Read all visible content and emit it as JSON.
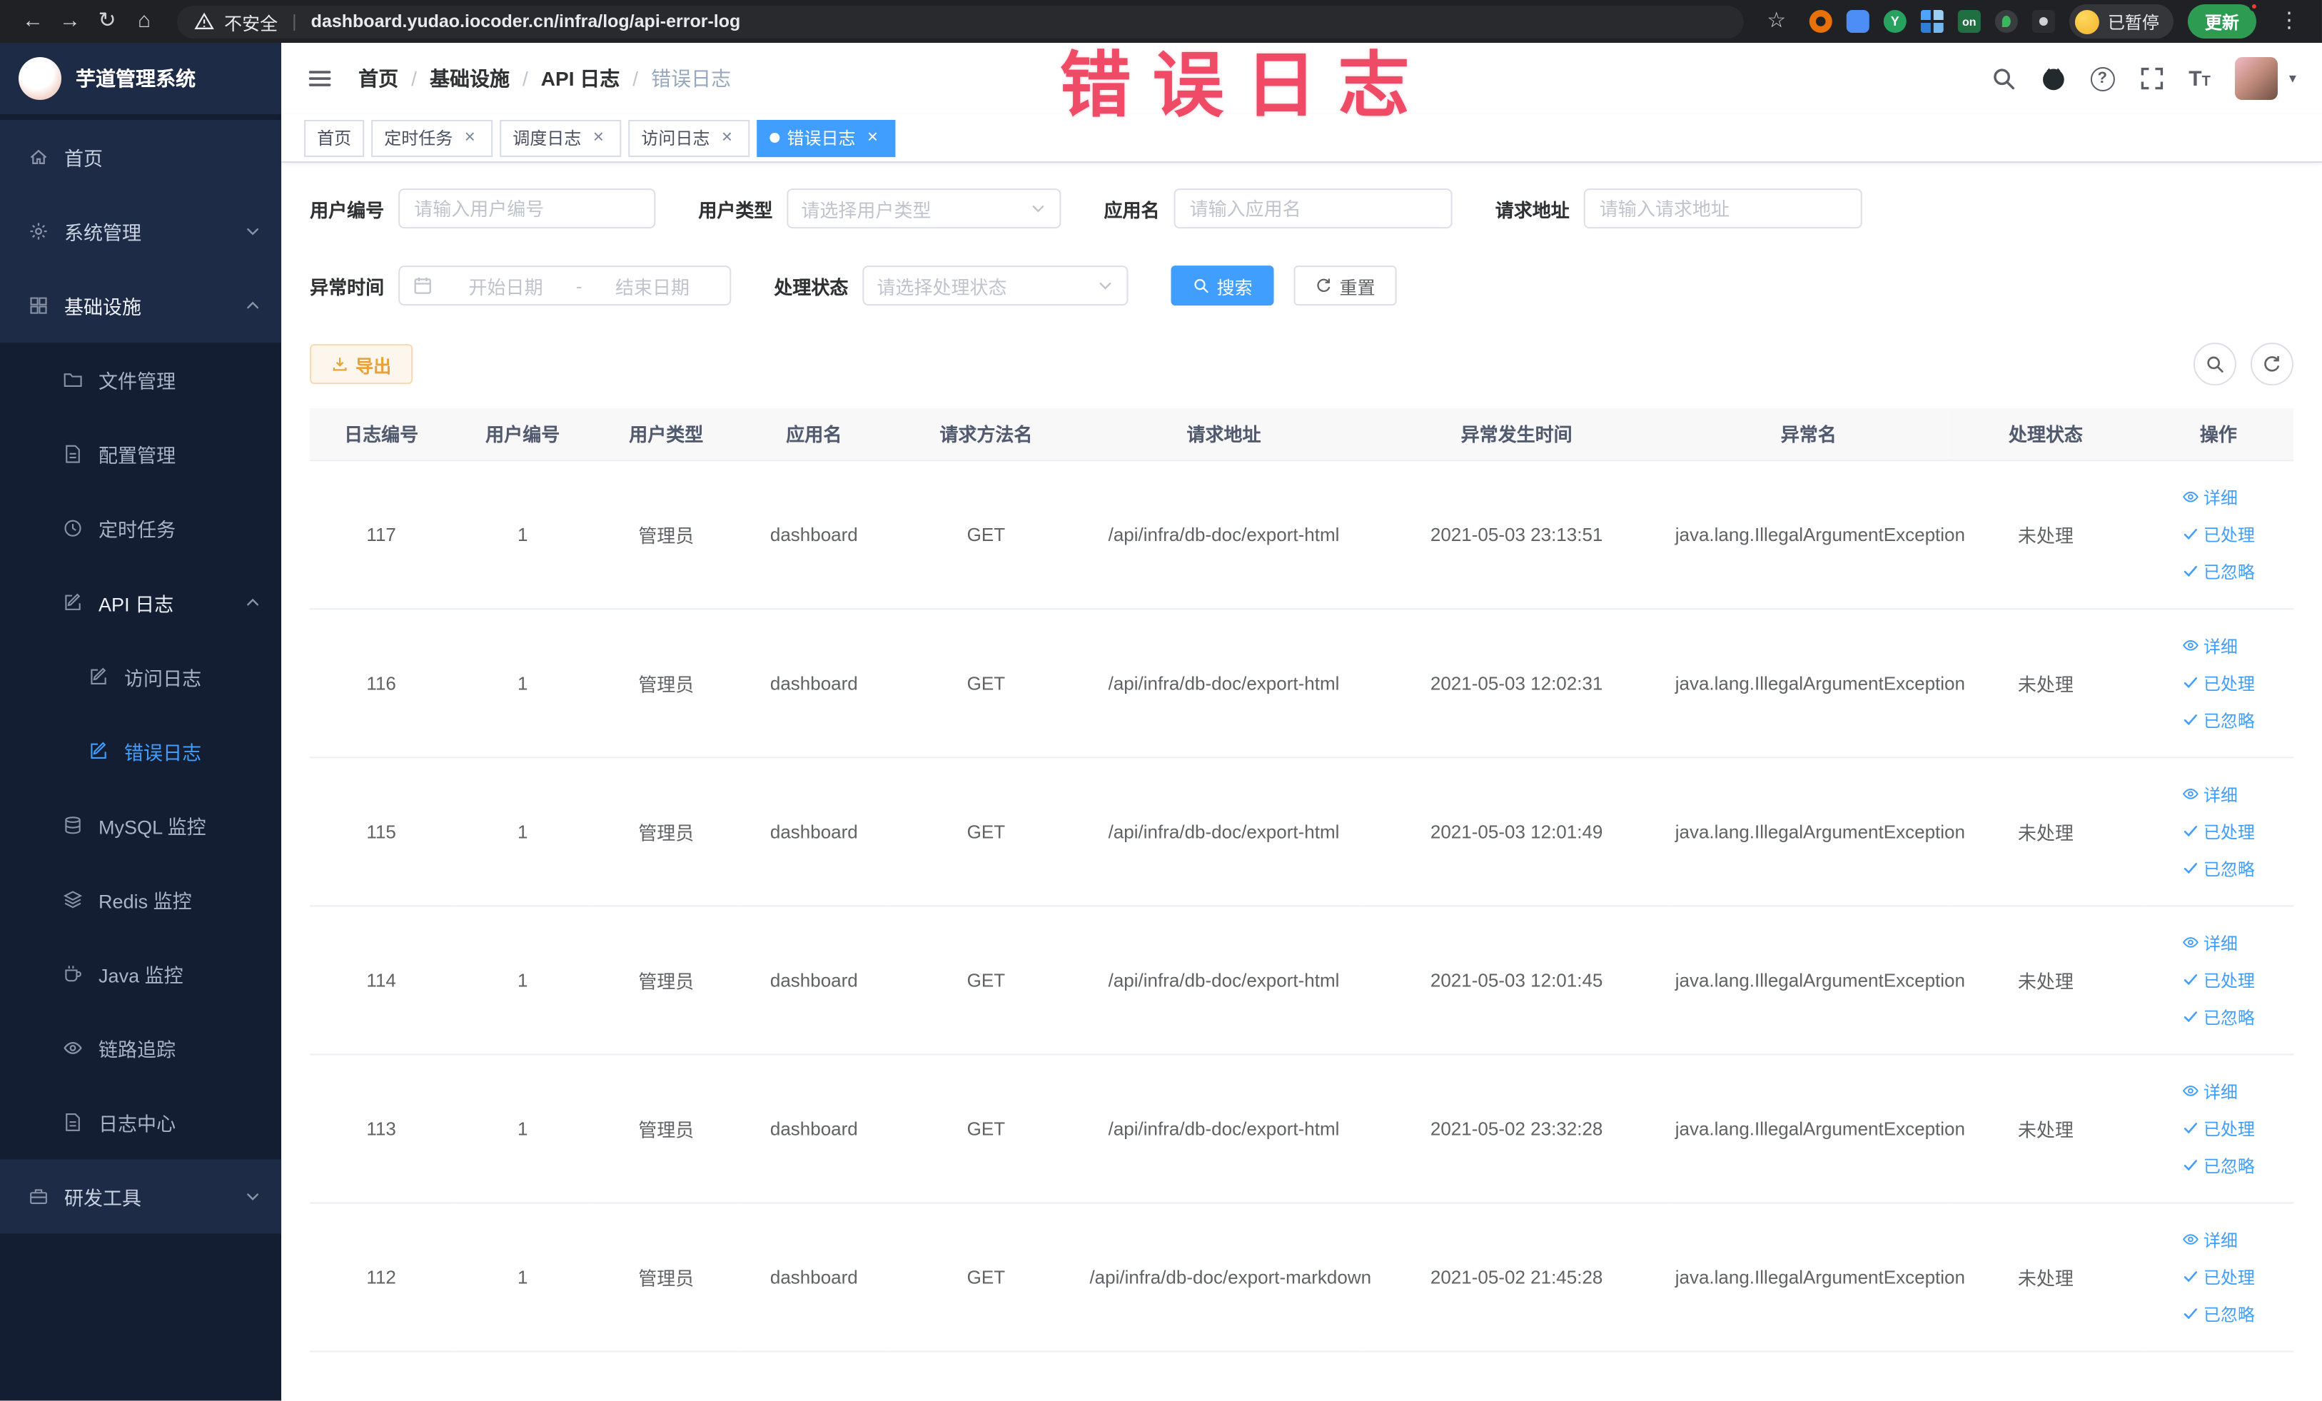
{
  "browser": {
    "security_label": "不安全",
    "url": "dashboard.yudao.iocoder.cn/infra/log/api-error-log",
    "profile_badge": "已暂停",
    "update_button": "更新"
  },
  "watermark": "错误日志",
  "sidebar": {
    "app_title": "芋道管理系统",
    "menu": [
      {
        "label": "首页"
      },
      {
        "label": "系统管理"
      },
      {
        "label": "基础设施"
      },
      {
        "label": "文件管理"
      },
      {
        "label": "配置管理"
      },
      {
        "label": "定时任务"
      },
      {
        "label": "API 日志"
      },
      {
        "label": "访问日志"
      },
      {
        "label": "错误日志"
      },
      {
        "label": "MySQL 监控"
      },
      {
        "label": "Redis 监控"
      },
      {
        "label": "Java 监控"
      },
      {
        "label": "链路追踪"
      },
      {
        "label": "日志中心"
      },
      {
        "label": "研发工具"
      }
    ]
  },
  "header": {
    "breadcrumb": [
      "首页",
      "基础设施",
      "API 日志",
      "错误日志"
    ]
  },
  "tags": [
    {
      "label": "首页",
      "closable": false,
      "active": false
    },
    {
      "label": "定时任务",
      "closable": true,
      "active": false
    },
    {
      "label": "调度日志",
      "closable": true,
      "active": false
    },
    {
      "label": "访问日志",
      "closable": true,
      "active": false
    },
    {
      "label": "错误日志",
      "closable": true,
      "active": true
    }
  ],
  "filters": {
    "user_id": {
      "label": "用户编号",
      "placeholder": "请输入用户编号"
    },
    "user_type": {
      "label": "用户类型",
      "placeholder": "请选择用户类型"
    },
    "app_name": {
      "label": "应用名",
      "placeholder": "请输入应用名"
    },
    "request_url": {
      "label": "请求地址",
      "placeholder": "请输入请求地址"
    },
    "exception_time": {
      "label": "异常时间",
      "start_placeholder": "开始日期",
      "separator": "-",
      "end_placeholder": "结束日期"
    },
    "process_status": {
      "label": "处理状态",
      "placeholder": "请选择处理状态"
    },
    "search_button": "搜索",
    "reset_button": "重置"
  },
  "toolbar": {
    "export_button": "导出"
  },
  "table": {
    "columns": [
      "日志编号",
      "用户编号",
      "用户类型",
      "应用名",
      "请求方法名",
      "请求地址",
      "异常发生时间",
      "异常名",
      "处理状态",
      "操作"
    ],
    "actions": [
      "详细",
      "已处理",
      "已忽略"
    ],
    "rows": [
      {
        "id": "117",
        "user_id": "1",
        "user_type": "管理员",
        "app": "dashboard",
        "method": "GET",
        "url": "/api/infra/db-doc/export-html",
        "time": "2021-05-03 23:13:51",
        "exception": "java.lang.IllegalArgumentException",
        "status": "未处理"
      },
      {
        "id": "116",
        "user_id": "1",
        "user_type": "管理员",
        "app": "dashboard",
        "method": "GET",
        "url": "/api/infra/db-doc/export-html",
        "time": "2021-05-03 12:02:31",
        "exception": "java.lang.IllegalArgumentException",
        "status": "未处理"
      },
      {
        "id": "115",
        "user_id": "1",
        "user_type": "管理员",
        "app": "dashboard",
        "method": "GET",
        "url": "/api/infra/db-doc/export-html",
        "time": "2021-05-03 12:01:49",
        "exception": "java.lang.IllegalArgumentException",
        "status": "未处理"
      },
      {
        "id": "114",
        "user_id": "1",
        "user_type": "管理员",
        "app": "dashboard",
        "method": "GET",
        "url": "/api/infra/db-doc/export-html",
        "time": "2021-05-03 12:01:45",
        "exception": "java.lang.IllegalArgumentException",
        "status": "未处理"
      },
      {
        "id": "113",
        "user_id": "1",
        "user_type": "管理员",
        "app": "dashboard",
        "method": "GET",
        "url": "/api/infra/db-doc/export-html",
        "time": "2021-05-02 23:32:28",
        "exception": "java.lang.IllegalArgumentException",
        "status": "未处理"
      },
      {
        "id": "112",
        "user_id": "1",
        "user_type": "管理员",
        "app": "dashboard",
        "method": "GET",
        "url": "/api/infra/db-doc/export-markdown",
        "time": "2021-05-02 21:45:28",
        "exception": "java.lang.IllegalArgumentException",
        "status": "未处理"
      }
    ]
  },
  "colors": {
    "accent": "#409eff",
    "warning": "#e6a23c",
    "watermark": "#ef4b66",
    "sidebar_bg": "#1e2b47",
    "sidebar_submenu_bg": "#141e33",
    "chrome_bg": "#202124",
    "tag_active_bg": "#409eff"
  }
}
